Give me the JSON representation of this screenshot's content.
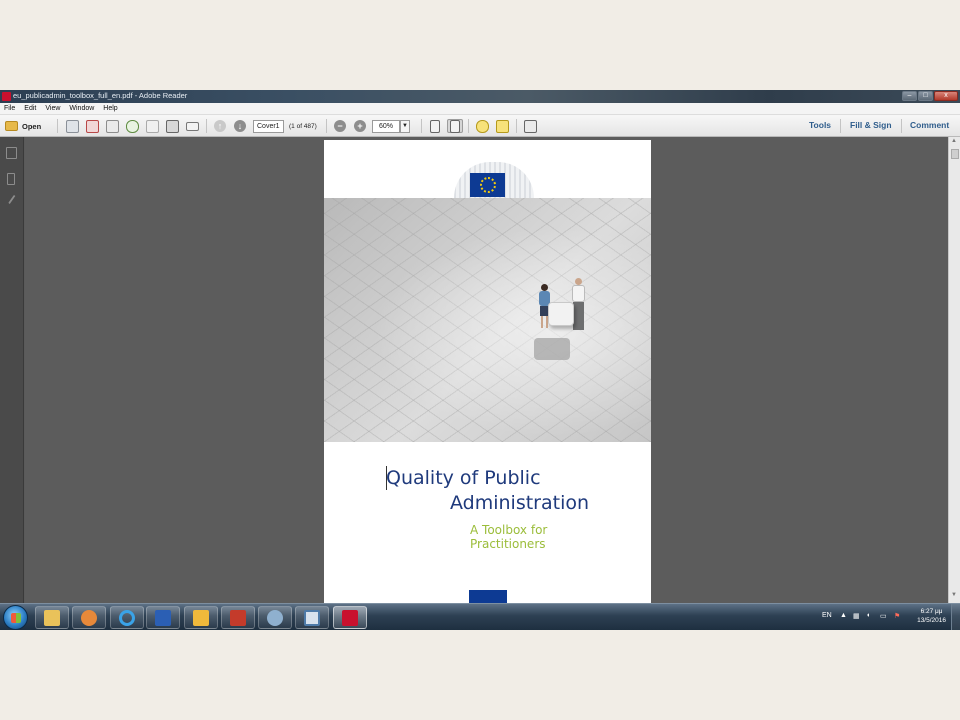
{
  "window": {
    "title": "eu_publicadmin_toolbox_full_en.pdf - Adobe Reader",
    "minimize": "–",
    "maximize": "□",
    "close": "x"
  },
  "menu": [
    "File",
    "Edit",
    "View",
    "Window",
    "Help"
  ],
  "toolbar": {
    "open_label": "Open",
    "page_field": "Cover1",
    "page_count": "(1 of 487)",
    "zoom_value": "60%",
    "tools_label": "Tools",
    "fill_sign_label": "Fill & Sign",
    "comment_label": "Comment"
  },
  "document": {
    "logo_text": "European\nCommission",
    "title_line1": "Quality of Public",
    "title_line2": "Administration",
    "subtitle_line1": "A Toolbox for",
    "subtitle_line2": "Practitioners",
    "colors": {
      "title": "#1f3a7c",
      "subtitle": "#9bbd3a",
      "eu_blue": "#0d3a93"
    }
  },
  "taskbar": {
    "language": "EN",
    "time": "6:27 μμ",
    "date": "13/5/2016",
    "apps": [
      "explorer-icon",
      "media-player-icon",
      "ie-icon",
      "word-icon",
      "outlook-icon",
      "access-icon",
      "app-icon",
      "powerpoint-icon",
      "adobe-reader-icon"
    ]
  }
}
